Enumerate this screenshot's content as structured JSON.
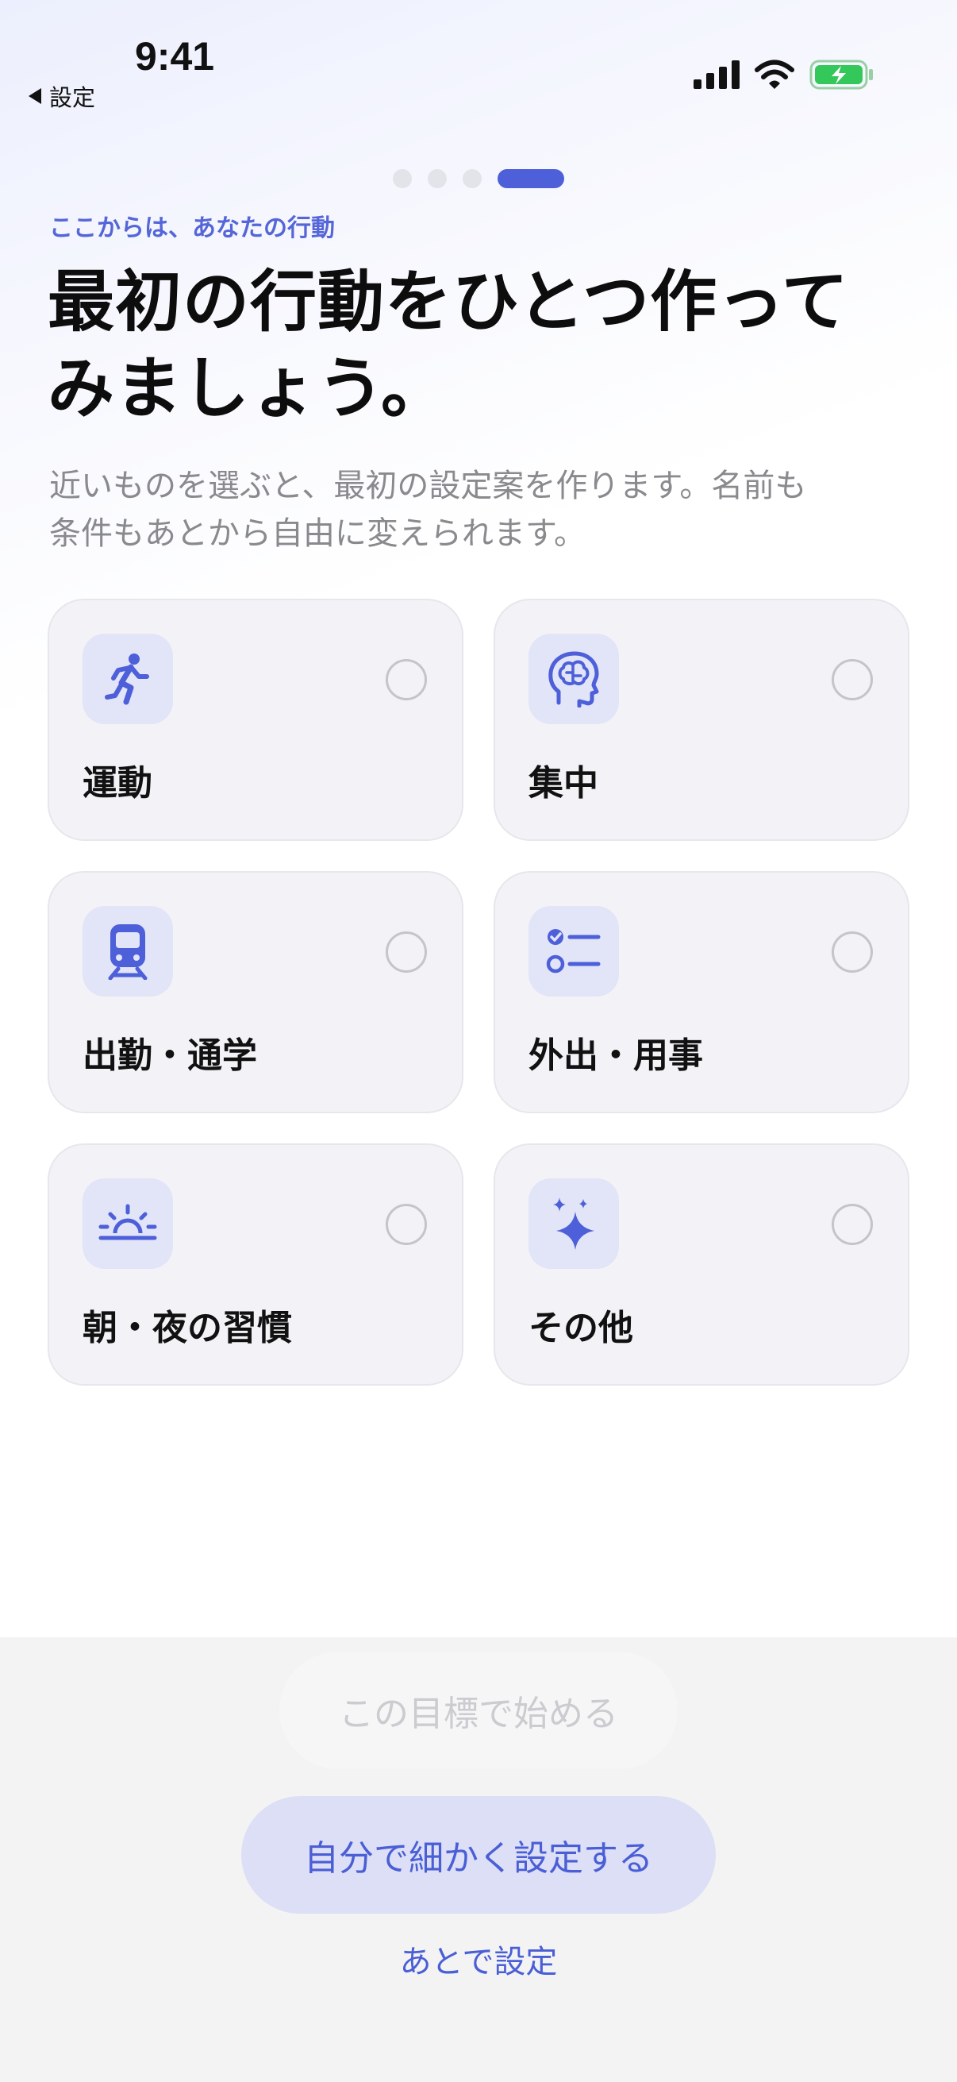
{
  "status_bar": {
    "time": "9:41",
    "back_label": "設定"
  },
  "onboarding": {
    "step_total": 4,
    "step_current": 4,
    "eyebrow": "ここからは、あなたの行動",
    "headline_line1": "最初の行動をひとつ作って",
    "headline_line2": "みましょう。",
    "subtext_line1": "近いものを選ぶと、最初の設定案を作ります。名前も",
    "subtext_line2": "条件もあとから自由に変えられます。"
  },
  "options": [
    {
      "label": "運動",
      "icon": "running-icon",
      "selected": false
    },
    {
      "label": "集中",
      "icon": "brain-icon",
      "selected": false
    },
    {
      "label": "出勤・通学",
      "icon": "train-icon",
      "selected": false
    },
    {
      "label": "外出・用事",
      "icon": "checklist-icon",
      "selected": false
    },
    {
      "label": "朝・夜の習慣",
      "icon": "sunrise-icon",
      "selected": false
    },
    {
      "label": "その他",
      "icon": "sparkles-icon",
      "selected": false
    }
  ],
  "actions": {
    "start_label": "この目標で始める",
    "custom_label": "自分で細かく設定する",
    "later_label": "あとで設定"
  },
  "colors": {
    "accent": "#4d5fd9",
    "icon_tile": "#e2e4f7",
    "card_bg": "#f3f3f7",
    "battery_fill": "#34c759"
  }
}
